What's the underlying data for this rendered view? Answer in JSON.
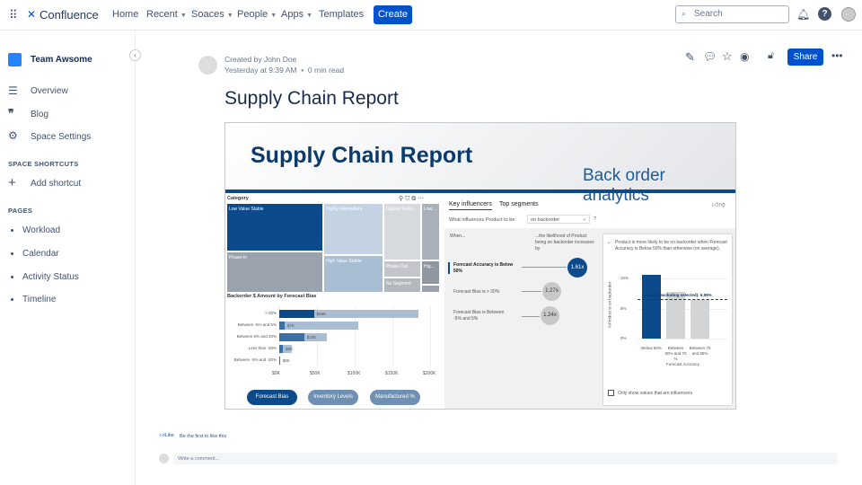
{
  "nav": {
    "brand": "Confluence",
    "items": [
      "Home",
      "Recent",
      "Soaces",
      "People",
      "Apps",
      "Templates"
    ],
    "create": "Create",
    "search_placeholder": "Search"
  },
  "sidebar": {
    "space": "Team Awsome",
    "items": [
      {
        "label": "Overview",
        "icon": "lines-icon"
      },
      {
        "label": "Blog",
        "icon": "quote-icon"
      },
      {
        "label": "Space Settings",
        "icon": "gear-icon"
      }
    ],
    "shortcuts_heading": "SPACE SHORTCUTS",
    "add_shortcut": "Add shortcut",
    "pages_heading": "PAGES",
    "pages": [
      "Workload",
      "Calendar",
      "Activity Status",
      "Timeline"
    ]
  },
  "page": {
    "author": "Created by John Doe",
    "meta": "Yesterday at 9:39 AM  •  0 min read",
    "title": "Supply Chain Report",
    "share": "Share",
    "like": "Like",
    "like_text": "Be the first to like this",
    "comment_placeholder": "Write a comment..."
  },
  "report": {
    "title": "Supply Chain Report",
    "subtitle": "Back order analytics",
    "treemap": {
      "title": "Category",
      "tiles": [
        "Low Value Stable",
        "Highly Intermittent",
        "Capital Syste...",
        "Low...",
        "Phase-In",
        "High Value Stable",
        "Phase-Out",
        "Hig...",
        "No Segment"
      ]
    },
    "bar": {
      "title": "Backorder $ Amount by Forecast Bias",
      "categories": [
        "> 20%",
        "Between -5% and 5%",
        "Between 5% and 20%",
        "Less than -20%",
        "Between -5% and -20%"
      ],
      "selected": [
        46,
        7,
        33,
        5,
        1
      ],
      "total": [
        185,
        105,
        63,
        17,
        1
      ],
      "labels": [
        "$46K",
        "$7K",
        "$33K",
        "$5K",
        "$0K"
      ],
      "ticks": [
        "$0K",
        "$50K",
        "$100K",
        "$150K",
        "$200K"
      ],
      "xlim": [
        0,
        200
      ]
    },
    "buttons": [
      "Forecast Bias",
      "Inventory Levels",
      "Manufactured %"
    ],
    "ki": {
      "tabs": [
        "Key influencers",
        "Top segments"
      ],
      "question": "What influences Product to be",
      "dropdown": "on backorder",
      "help": "?",
      "when": "When...",
      "likelihood": "...the likelihood of Product being on backorder increases by",
      "influencers": [
        {
          "label": "Forecast Accuracy is Below 50%",
          "value": "1.61x"
        },
        {
          "label": "Forecast Bias is > 20%",
          "value": "1.27x"
        },
        {
          "label": "Forecast Bias is Between -5% and 5%",
          "value": "1.24x"
        }
      ],
      "detail": "Product is more likely to be on backorder when Forecast Accuracy is Below 50% than otherwise (on average).",
      "ylabel": "%Product is on backorder",
      "yticks": [
        "10%",
        "5%",
        "0%"
      ],
      "xlabel": "Forecast Accuracy",
      "bars": [
        {
          "label": "Below 50%",
          "value": 10.6
        },
        {
          "label": "Between 50% and 70 %",
          "value": 7.8
        },
        {
          "label": "Between 70 and 85%",
          "value": 6.4
        }
      ],
      "average": "Average (excluding selected): 6.59%",
      "average_value": 6.59,
      "checkbox": "Only show values that are influencers"
    }
  },
  "colors": {
    "primary": "#0052cc",
    "report_dark": "#0b4a8b",
    "report_light": "#a9bdd3"
  }
}
